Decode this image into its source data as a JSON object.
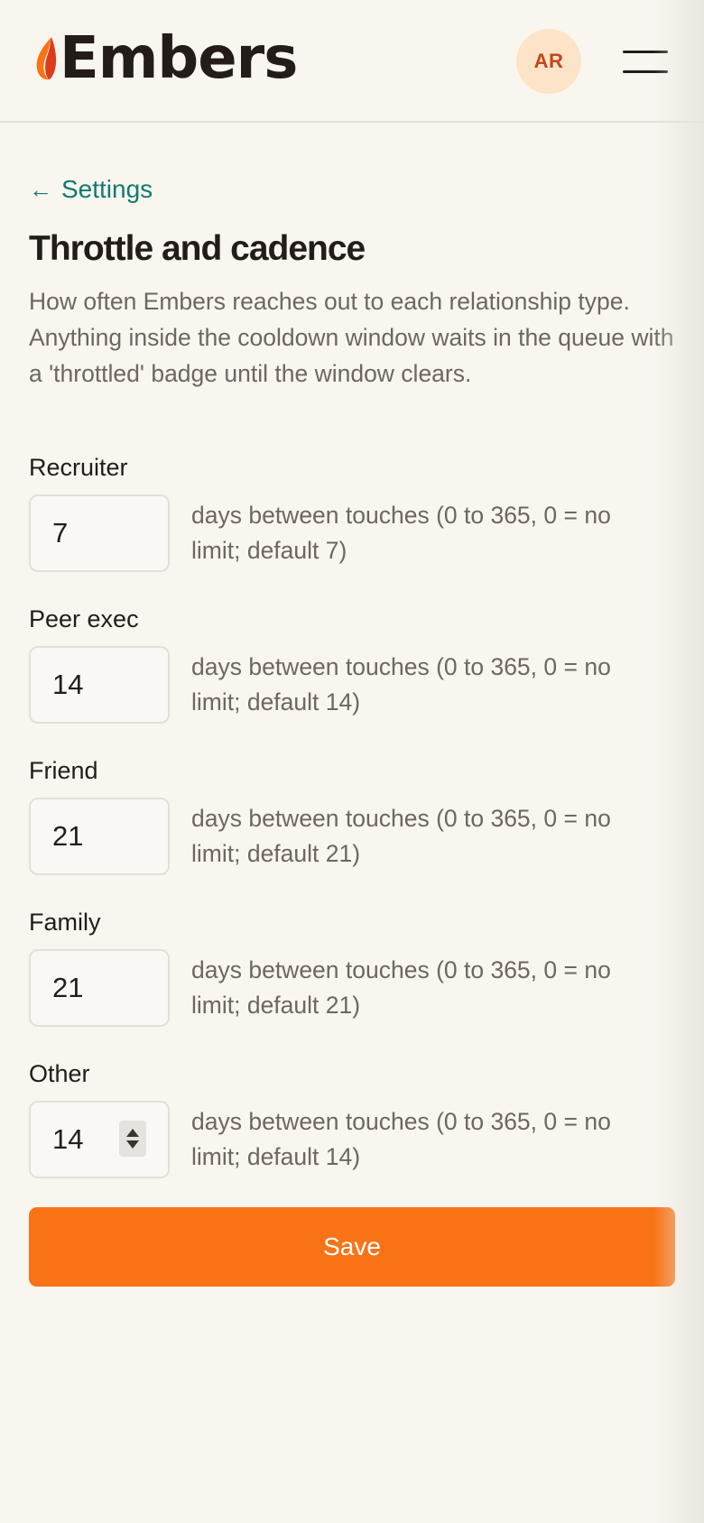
{
  "header": {
    "brand_name": "Embers",
    "avatar_initials": "AR",
    "menu_icon": "hamburger-icon",
    "logo_icon": "flame-icon",
    "colors": {
      "flame_orange": "#f97316",
      "flame_red": "#dc3d17",
      "avatar_bg": "#fde4c8",
      "avatar_text": "#c2461b"
    }
  },
  "nav": {
    "back_arrow": "←",
    "back_label": "Settings",
    "back_color": "#127a6e"
  },
  "page": {
    "title": "Throttle and cadence",
    "intro": "How often Embers reaches out to each relationship type. Anything inside the cooldown window waits in the queue with a 'throttled' badge until the window clears."
  },
  "fields": [
    {
      "label": "Recruiter",
      "value": "7",
      "hint": "days between touches (0 to 365, 0 = no limit; default 7)"
    },
    {
      "label": "Peer exec",
      "value": "14",
      "hint": "days between touches (0 to 365, 0 = no limit; default 14)"
    },
    {
      "label": "Friend",
      "value": "21",
      "hint": "days between touches (0 to 365, 0 = no limit; default 21)"
    },
    {
      "label": "Family",
      "value": "21",
      "hint": "days between touches (0 to 365, 0 = no limit; default 21)"
    },
    {
      "label": "Other",
      "value": "14",
      "hint": "days between touches (0 to 365, 0 = no limit; default 14)"
    }
  ],
  "actions": {
    "save_label": "Save",
    "save_color": "#f97316"
  }
}
